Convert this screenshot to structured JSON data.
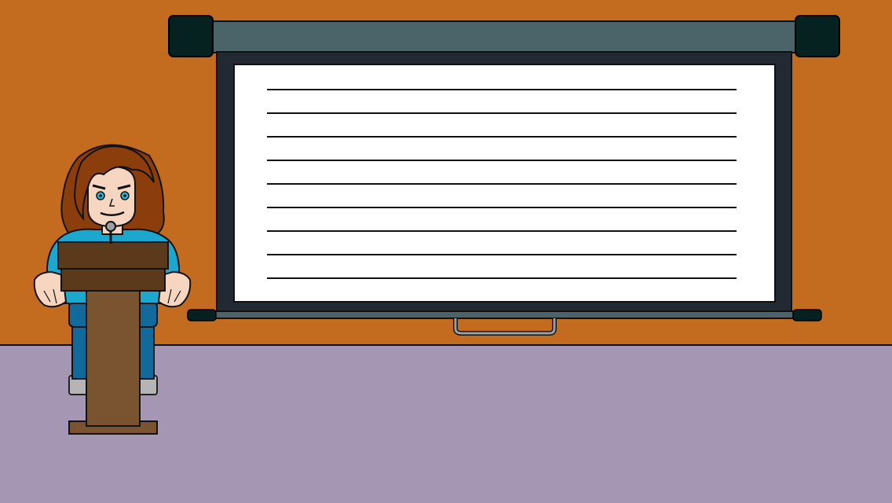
{
  "scene": {
    "name": "presentation-room",
    "elements": [
      "wall",
      "floor",
      "projector-screen",
      "presenter",
      "podium"
    ],
    "screen": {
      "blank_lines": 9,
      "content_text": ""
    },
    "colors": {
      "wall": "#c36c1f",
      "floor": "#a596b3",
      "screen_housing": "#4a6469",
      "screen_endcap": "#062220",
      "screen_frame": "#212a33",
      "screen_surface": "#ffffff",
      "podium_wood": "#7a5430",
      "podium_dark": "#5a3a1a",
      "hair": "#8b3d0c",
      "skin": "#f6d5c1",
      "shirt": "#1ba7ce",
      "pants": "#126a9a",
      "shoes": "#b5b5b5",
      "eyes": "#27b8d8"
    }
  }
}
